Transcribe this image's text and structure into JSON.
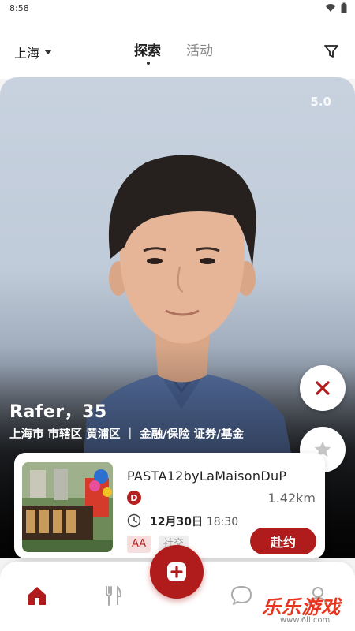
{
  "status_bar": {
    "time": "8:58"
  },
  "header": {
    "city": "上海",
    "tabs": [
      {
        "label": "探索",
        "active": true
      },
      {
        "label": "活动",
        "active": false
      }
    ]
  },
  "profile": {
    "rating": "5.0",
    "name_age": "Rafer，35",
    "meta": "上海市 市辖区 黄浦区 ｜ 金融/保险  证券/基金"
  },
  "event": {
    "title": "PASTA12byLaMaisonDuP",
    "badge": "D",
    "distance": "1.42km",
    "date": "12月30日",
    "time": "18:30",
    "tags": [
      "AA",
      "社交"
    ],
    "join_label": "赴约"
  },
  "watermark": {
    "text": "乐乐游戏",
    "url": "www.6ll.com"
  },
  "colors": {
    "accent": "#b01c1c",
    "accent_light": "#f6dede"
  },
  "icons": {
    "filter": "filter-icon",
    "dislike": "close-icon",
    "star": "star-icon",
    "clock": "clock-icon",
    "home": "home-icon",
    "dining": "fork-knife-icon",
    "add": "add-icon",
    "chat": "chat-bubble-icon",
    "profile": "user-icon"
  }
}
